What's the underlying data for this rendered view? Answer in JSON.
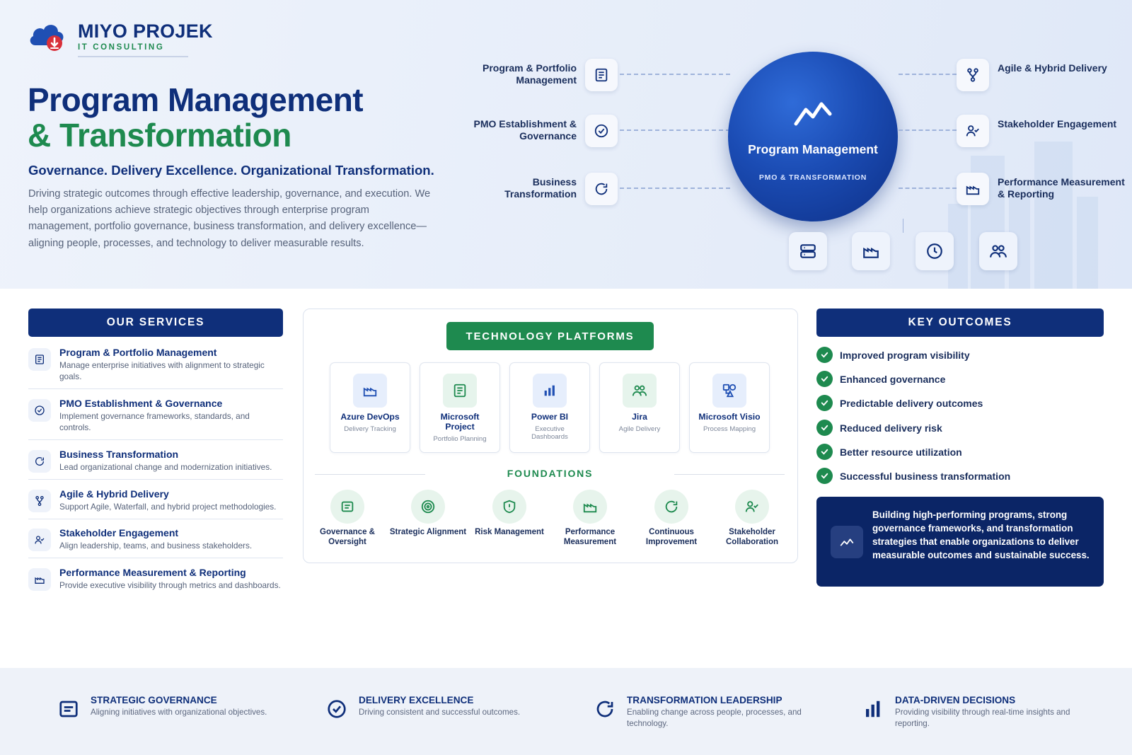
{
  "brand": {
    "name": "MIYO PROJEK",
    "tagline": "IT CONSULTING"
  },
  "hero": {
    "title_line1": "Program Management",
    "title_line2": "& Transformation",
    "tagline": "Governance. Delivery Excellence. Organizational Transformation.",
    "description": "Driving strategic outcomes through effective leadership, governance, and execution. We help organizations achieve strategic objectives through enterprise program management, portfolio governance, business transformation, and delivery excellence—aligning people, processes, and technology to deliver measurable results."
  },
  "diagram": {
    "hub_title": "Program Management",
    "hub_subtitle": "PMO & TRANSFORMATION",
    "hub_icon": "trend-line-icon",
    "left": [
      {
        "label": "Program & Portfolio Management",
        "icon": "document-icon"
      },
      {
        "label": "PMO Establishment & Governance",
        "icon": "check-circle-icon"
      },
      {
        "label": "Business Transformation",
        "icon": "refresh-icon"
      }
    ],
    "right": [
      {
        "label": "Agile & Hybrid Delivery",
        "icon": "branch-icon"
      },
      {
        "label": "Stakeholder Engagement",
        "icon": "user-check-icon"
      },
      {
        "label": "Performance Measurement & Reporting",
        "icon": "factory-icon"
      }
    ],
    "bottom_icons": [
      "server-icon",
      "factory-icon",
      "clock-icon",
      "users-icon"
    ]
  },
  "services": {
    "heading": "OUR SERVICES",
    "items": [
      {
        "title": "Program & Portfolio Management",
        "desc": "Manage enterprise initiatives with alignment to strategic goals.",
        "icon": "document-icon"
      },
      {
        "title": "PMO Establishment & Governance",
        "desc": "Implement governance frameworks, standards, and controls.",
        "icon": "check-circle-icon"
      },
      {
        "title": "Business Transformation",
        "desc": "Lead organizational change and modernization initiatives.",
        "icon": "refresh-icon"
      },
      {
        "title": "Agile & Hybrid Delivery",
        "desc": "Support Agile, Waterfall, and hybrid project methodologies.",
        "icon": "branch-icon"
      },
      {
        "title": "Stakeholder Engagement",
        "desc": "Align leadership, teams, and business stakeholders.",
        "icon": "user-check-icon"
      },
      {
        "title": "Performance Measurement & Reporting",
        "desc": "Provide executive visibility through metrics and dashboards.",
        "icon": "factory-icon"
      }
    ]
  },
  "tech": {
    "heading": "TECHNOLOGY PLATFORMS",
    "platforms": [
      {
        "name": "Azure DevOps",
        "sub": "Delivery Tracking",
        "icon": "factory-icon",
        "color": "#e6eefc",
        "fg": "#1f4fb3"
      },
      {
        "name": "Microsoft Project",
        "sub": "Portfolio Planning",
        "icon": "document-icon",
        "color": "#e6f4ec",
        "fg": "#1e8a4f"
      },
      {
        "name": "Power BI",
        "sub": "Executive Dashboards",
        "icon": "bar-chart-icon",
        "color": "#e6eefc",
        "fg": "#1f4fb3"
      },
      {
        "name": "Jira",
        "sub": "Agile Delivery",
        "icon": "users-icon",
        "color": "#e6f4ec",
        "fg": "#1e8a4f"
      },
      {
        "name": "Microsoft Visio",
        "sub": "Process Mapping",
        "icon": "shapes-icon",
        "color": "#e6eefc",
        "fg": "#1f4fb3"
      }
    ],
    "foundations_heading": "FOUNDATIONS",
    "foundations": [
      {
        "label": "Governance & Oversight",
        "icon": "document-icon"
      },
      {
        "label": "Strategic Alignment",
        "icon": "target-icon"
      },
      {
        "label": "Risk Management",
        "icon": "shield-icon"
      },
      {
        "label": "Performance Measurement",
        "icon": "factory-icon"
      },
      {
        "label": "Continuous Improvement",
        "icon": "refresh-icon"
      },
      {
        "label": "Stakeholder Collaboration",
        "icon": "user-check-icon"
      }
    ]
  },
  "outcomes": {
    "heading": "KEY OUTCOMES",
    "items": [
      "Improved program visibility",
      "Enhanced governance",
      "Predictable delivery outcomes",
      "Reduced delivery risk",
      "Better resource utilization",
      "Successful business transformation"
    ],
    "quote": "Building high-performing programs, strong governance frameworks, and transformation strategies that enable organizations to deliver measurable outcomes and sustainable success."
  },
  "footer": [
    {
      "title": "STRATEGIC GOVERNANCE",
      "desc": "Aligning initiatives with organizational objectives.",
      "icon": "document-icon"
    },
    {
      "title": "DELIVERY EXCELLENCE",
      "desc": "Driving consistent and successful outcomes.",
      "icon": "check-circle-icon"
    },
    {
      "title": "TRANSFORMATION LEADERSHIP",
      "desc": "Enabling change across people, processes, and technology.",
      "icon": "refresh-icon"
    },
    {
      "title": "DATA-DRIVEN DECISIONS",
      "desc": "Providing visibility through real-time insights and reporting.",
      "icon": "bar-chart-icon"
    }
  ],
  "colors": {
    "navy": "#0f2f7a",
    "green": "#1e8a4f",
    "logo_red": "#d9303a",
    "logo_blue": "#1f4fb3"
  }
}
